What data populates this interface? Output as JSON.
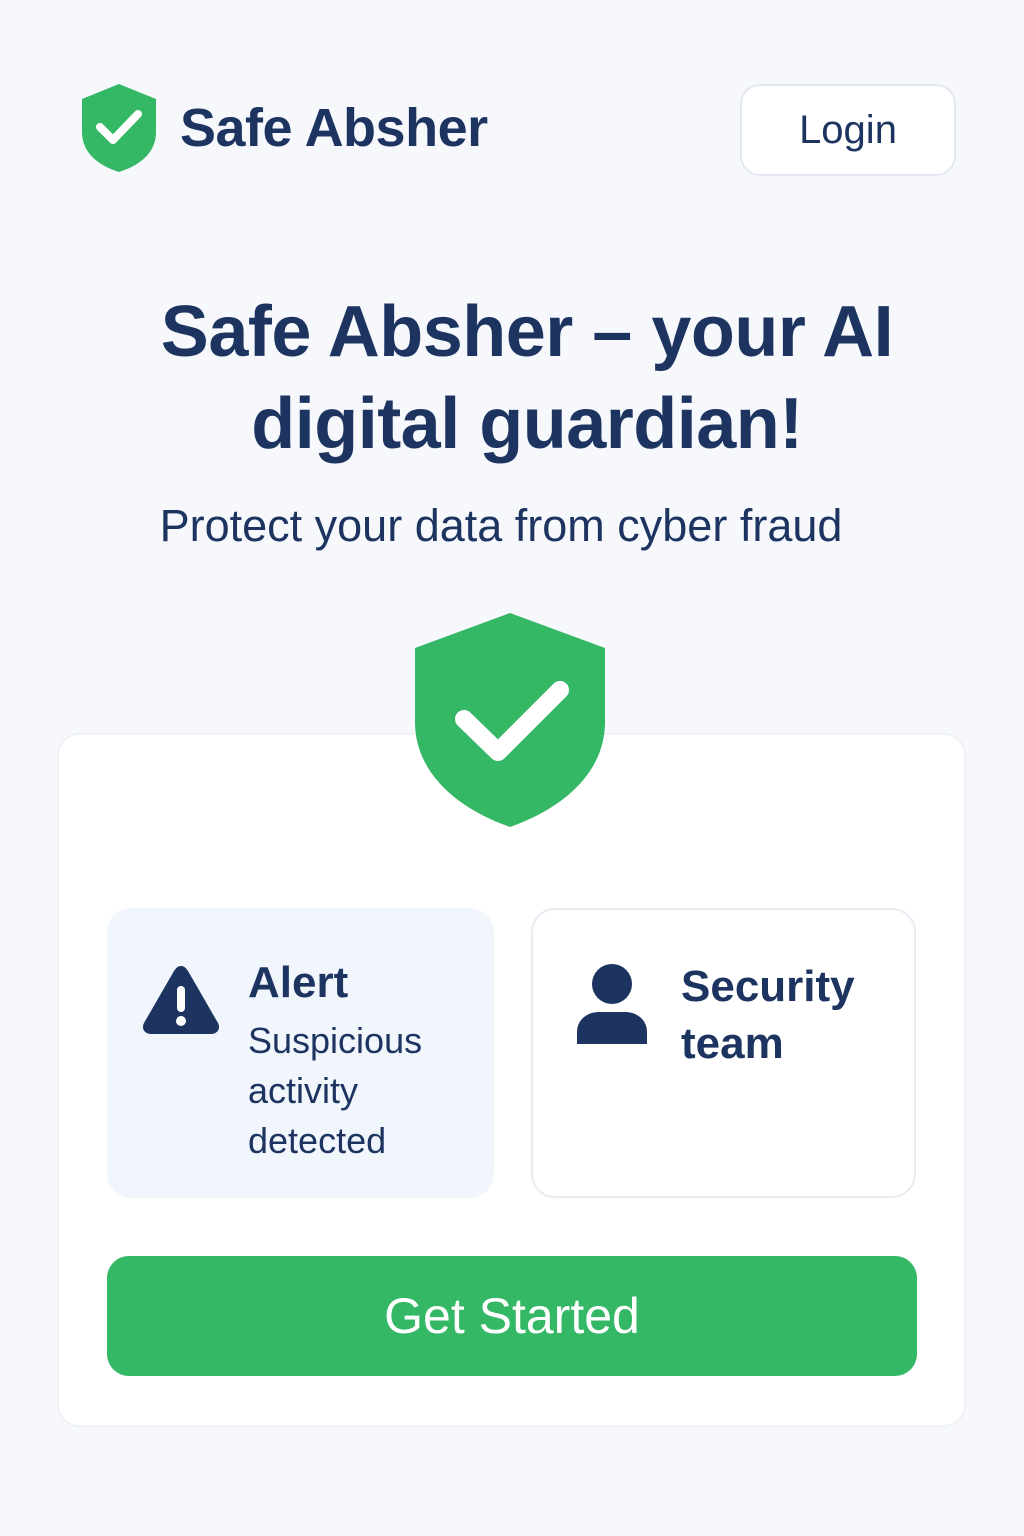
{
  "colors": {
    "accent": "#35b865",
    "navy": "#1d3461",
    "background": "#f6f8fc",
    "card": "#ffffff",
    "alert_card_bg": "#f1f6fd"
  },
  "header": {
    "brand_name": "Safe Absher",
    "brand_icon": "shield-check-icon",
    "login_label": "Login"
  },
  "hero": {
    "title_line1": "Safe Absher – your AI",
    "title_line2": "digital guardian!",
    "subtitle": "Protect your data from cyber fraud",
    "icon": "shield-check-icon"
  },
  "cards": {
    "alert": {
      "icon": "warning-icon",
      "title": "Alert",
      "text": "Suspicious activity detected"
    },
    "team": {
      "icon": "user-icon",
      "title": "Security team"
    }
  },
  "cta": {
    "label": "Get Started"
  }
}
